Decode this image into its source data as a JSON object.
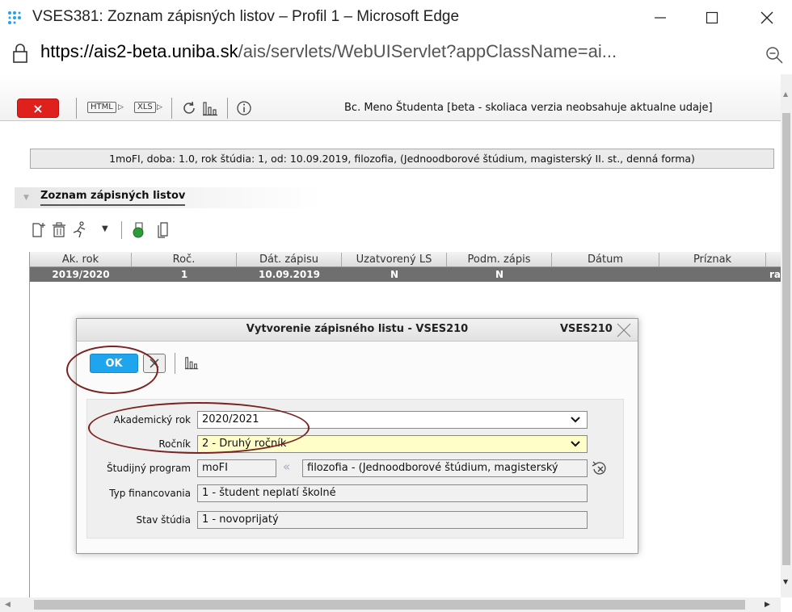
{
  "window": {
    "title": "VSES381: Zoznam zápisných listov – Profil 1 – Microsoft Edge",
    "url_host": "https://ais2-beta.uniba.sk",
    "url_rest": "/ais/servlets/WebUIServlet?appClassName=ai..."
  },
  "toolbar": {
    "close_label": "×",
    "html_label": "HTML",
    "xls_label": "XLS",
    "user_info": "Bc. Meno Študenta [beta - skoliaca verzia neobsahuje aktualne udaje]"
  },
  "info_bar": "1moFI, doba: 1.0, rok štúdia: 1, od: 10.09.2019, filozofia, (Jednoodborové štúdium, magisterský II. st., denná forma)",
  "section": {
    "title": "Zoznam zápisných listov"
  },
  "grid": {
    "columns": [
      "Ak. rok",
      "Roč.",
      "Dát. zápisu",
      "Uzatvorený LS",
      "Podm. zápis",
      "Dátum",
      "Príznak"
    ],
    "rows": [
      {
        "ak_rok": "2019/2020",
        "roc": "1",
        "dat_zapisu": "10.09.2019",
        "uzatvoreny": "N",
        "podm": "N",
        "datum": "",
        "priznak": "",
        "extra": "ra"
      }
    ]
  },
  "dialog": {
    "title": "Vytvorenie zápisného listu - VSES210",
    "code": "VSES210",
    "ok_label": "OK",
    "fields": {
      "akademicky_rok": {
        "label": "Akademický rok",
        "value": "2020/2021"
      },
      "rocnik": {
        "label": "Ročník",
        "value": "2 - Druhý ročník"
      },
      "program": {
        "label": "Študijný program",
        "code": "moFI",
        "value": "filozofia - (Jednoodborové štúdium, magisterský"
      },
      "financovanie": {
        "label": "Typ financovania",
        "value": "1 - študent neplatí školné"
      },
      "stav": {
        "label": "Stav štúdia",
        "value": "1 - novoprijatý"
      }
    }
  },
  "colors": {
    "close_red": "#e0201c",
    "ok_blue": "#1fa4ee",
    "selected_row": "#6f6f6f",
    "required_field": "#fffec9",
    "annotation": "#7a2222"
  }
}
